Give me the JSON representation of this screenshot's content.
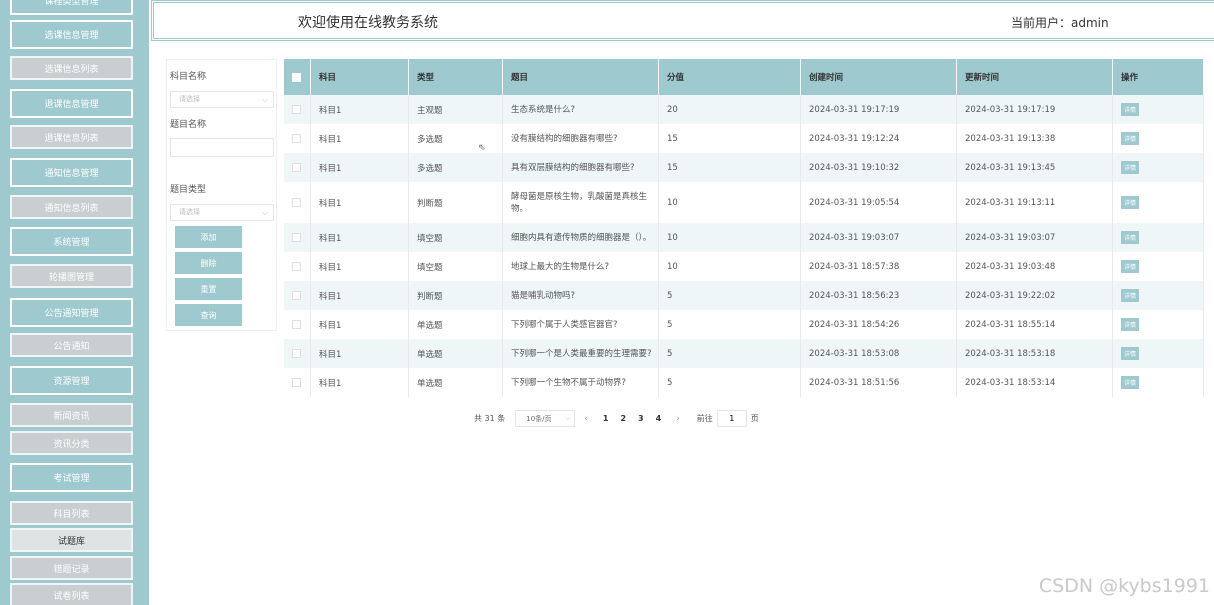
{
  "sidebar": {
    "items": [
      {
        "label": "课程类型管理",
        "kind": "main"
      },
      {
        "label": "选课信息管理",
        "kind": "main"
      },
      {
        "label": "选课信息列表",
        "kind": "sub"
      },
      {
        "label": "退课信息管理",
        "kind": "main"
      },
      {
        "label": "退课信息列表",
        "kind": "sub"
      },
      {
        "label": "通知信息管理",
        "kind": "main"
      },
      {
        "label": "通知信息列表",
        "kind": "sub"
      },
      {
        "label": "系统管理",
        "kind": "main"
      },
      {
        "label": "轮播图管理",
        "kind": "sub"
      },
      {
        "label": "公告通知管理",
        "kind": "main"
      },
      {
        "label": "公告通知",
        "kind": "sub"
      },
      {
        "label": "资源管理",
        "kind": "main"
      },
      {
        "label": "新闻资讯",
        "kind": "sub"
      },
      {
        "label": "资讯分类",
        "kind": "sub"
      },
      {
        "label": "考试管理",
        "kind": "main"
      },
      {
        "label": "科目列表",
        "kind": "sub"
      },
      {
        "label": "试题库",
        "kind": "sub",
        "active": true
      },
      {
        "label": "错题记录",
        "kind": "sub"
      },
      {
        "label": "试卷列表",
        "kind": "sub"
      }
    ]
  },
  "header": {
    "welcome": "欢迎使用在线教务系统",
    "current_user": "当前用户：admin"
  },
  "search": {
    "subject_label": "科目名称",
    "subject_placeholder": "请选择",
    "title_label": "题目名称",
    "title_value": "",
    "type_label": "题目类型",
    "type_placeholder": "请选择",
    "buttons": {
      "add": "添加",
      "delete": "删除",
      "reset": "重置",
      "query": "查询"
    }
  },
  "table": {
    "headers": [
      "科目",
      "类型",
      "题目",
      "分值",
      "创建时间",
      "更新时间",
      "操作"
    ],
    "detail_label": "详情",
    "rows": [
      {
        "subject": "科目1",
        "type": "主观题",
        "question": "生态系统是什么?",
        "score": "20",
        "created": "2024-03-31 19:17:19",
        "updated": "2024-03-31 19:17:19"
      },
      {
        "subject": "科目1",
        "type": "多选题",
        "question": "没有膜结构的细胞器有哪些?",
        "score": "15",
        "created": "2024-03-31 19:12:24",
        "updated": "2024-03-31 19:13:38"
      },
      {
        "subject": "科目1",
        "type": "多选题",
        "question": "具有双层膜结构的细胞器有哪些?",
        "score": "15",
        "created": "2024-03-31 19:10:32",
        "updated": "2024-03-31 19:13:45"
      },
      {
        "subject": "科目1",
        "type": "判断题",
        "question": "酵母菌是原核生物，乳酸菌是真核生物。",
        "score": "10",
        "created": "2024-03-31 19:05:54",
        "updated": "2024-03-31 19:13:11"
      },
      {
        "subject": "科目1",
        "type": "填空题",
        "question": "细胞内具有遗传物质的细胞器是（）。",
        "score": "10",
        "created": "2024-03-31 19:03:07",
        "updated": "2024-03-31 19:03:07"
      },
      {
        "subject": "科目1",
        "type": "填空题",
        "question": "地球上最大的生物是什么?",
        "score": "10",
        "created": "2024-03-31 18:57:38",
        "updated": "2024-03-31 19:03:48"
      },
      {
        "subject": "科目1",
        "type": "判断题",
        "question": "猫是哺乳动物吗?",
        "score": "5",
        "created": "2024-03-31 18:56:23",
        "updated": "2024-03-31 19:22:02"
      },
      {
        "subject": "科目1",
        "type": "单选题",
        "question": "下列哪个属于人类感官器官?",
        "score": "5",
        "created": "2024-03-31 18:54:26",
        "updated": "2024-03-31 18:55:14"
      },
      {
        "subject": "科目1",
        "type": "单选题",
        "question": "下列哪一个是人类最重要的生理需要?",
        "score": "5",
        "created": "2024-03-31 18:53:08",
        "updated": "2024-03-31 18:53:18"
      },
      {
        "subject": "科目1",
        "type": "单选题",
        "question": "下列哪一个生物不属于动物界?",
        "score": "5",
        "created": "2024-03-31 18:51:56",
        "updated": "2024-03-31 18:53:14"
      }
    ]
  },
  "pagination": {
    "total": "共 31 条",
    "page_size": "10条/页",
    "pages": [
      "1",
      "2",
      "3",
      "4"
    ],
    "goto_label": "前往",
    "goto_value": "1",
    "page_suffix": "页"
  },
  "watermark": "CSDN @kybs1991"
}
